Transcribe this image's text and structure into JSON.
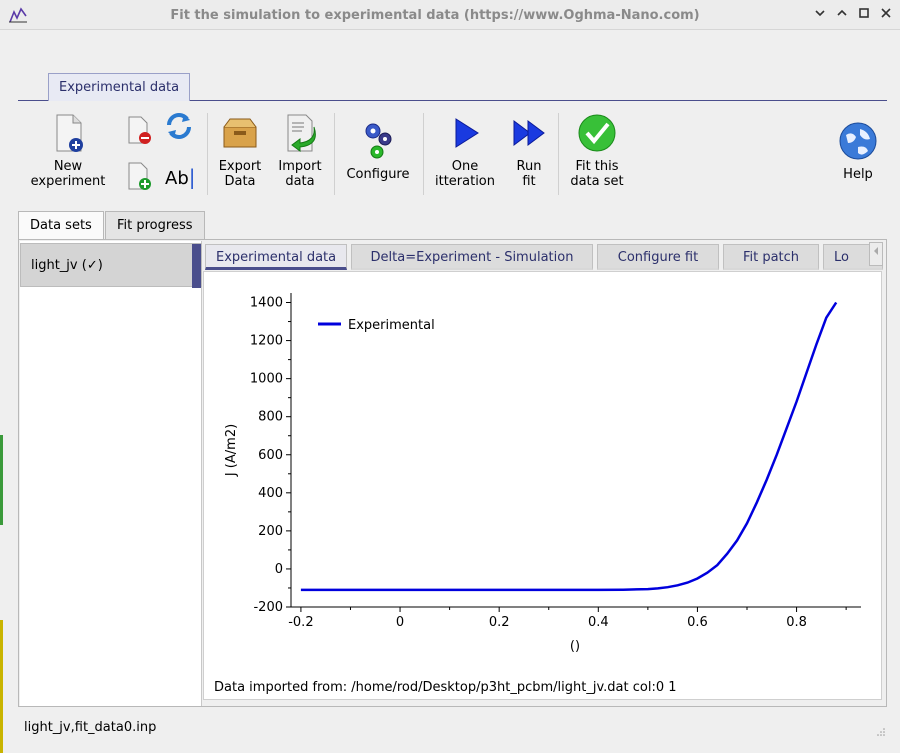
{
  "window": {
    "title": "Fit the simulation to experimental data (https://www.Oghma-Nano.com)",
    "minimize_icon": "chevron-down-icon",
    "restore_icon": "chevron-up-icon",
    "maximize_icon": "square-icon",
    "close_icon": "x-icon"
  },
  "outer_tab": {
    "label": "Experimental data"
  },
  "toolbar": {
    "new_experiment": "New\nexperiment",
    "export_data": "Export\nData",
    "import_data": "Import\ndata",
    "configure": "Configure",
    "one_iteration": "One\nitteration",
    "run_fit": "Run\nfit",
    "fit_this": "Fit this\ndata set",
    "help": "Help",
    "rename_text": "Ab"
  },
  "dataset_tabs": [
    "Data sets",
    "Fit progress"
  ],
  "datasets": [
    {
      "label": "light_jv (✓)"
    }
  ],
  "inner_tabs": [
    "Experimental data",
    "Delta=Experiment - Simulation",
    "Configure fit",
    "Fit patch",
    "Lo"
  ],
  "import_note": "Data imported from: /home/rod/Desktop/p3ht_pcbm/light_jv.dat col:0 1",
  "status": "light_jv,fit_data0.inp",
  "colors": {
    "accent": "#4a4e8c",
    "series": "#0000dd"
  },
  "chart_data": {
    "type": "line",
    "xlabel": "()",
    "ylabel": "J (A/m2)",
    "xlim": [
      -0.22,
      0.93
    ],
    "ylim": [
      -200,
      1450
    ],
    "xticks": [
      -0.2,
      0,
      0.2,
      0.4,
      0.6,
      0.8
    ],
    "xtick_labels": [
      "-0.2",
      "0",
      "0.2",
      "0.4",
      "0.6",
      "0.8"
    ],
    "yticks": [
      -200,
      0,
      200,
      400,
      600,
      800,
      1000,
      1200,
      1400
    ],
    "ytick_labels": [
      "-200",
      "0",
      "200",
      "400",
      "600",
      "800",
      "1000",
      "1200",
      "1400"
    ],
    "legend_position": "top-left",
    "grid": false,
    "series": [
      {
        "name": "Experimental",
        "x": [
          -0.2,
          -0.1,
          0.0,
          0.1,
          0.2,
          0.3,
          0.4,
          0.45,
          0.5,
          0.52,
          0.54,
          0.56,
          0.58,
          0.6,
          0.62,
          0.64,
          0.66,
          0.68,
          0.7,
          0.72,
          0.74,
          0.76,
          0.78,
          0.8,
          0.82,
          0.84,
          0.86,
          0.88
        ],
        "y": [
          -110,
          -110,
          -110,
          -110,
          -110,
          -110,
          -110,
          -109,
          -106,
          -102,
          -96,
          -86,
          -72,
          -50,
          -20,
          20,
          80,
          150,
          240,
          350,
          470,
          600,
          740,
          880,
          1030,
          1180,
          1320,
          1400
        ]
      }
    ]
  }
}
